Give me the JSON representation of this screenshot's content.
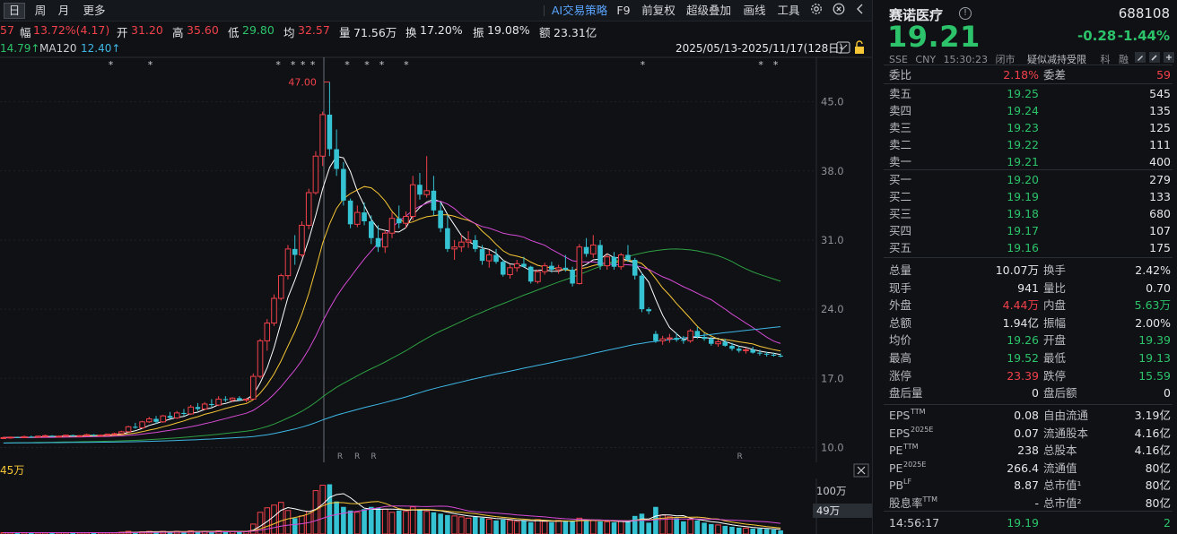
{
  "toolbar": {
    "period_day": "日",
    "period_week": "周",
    "period_month": "月",
    "more": "更多",
    "ai_strategy": "AI交易策略",
    "f9": "F9",
    "adjust": "前复权",
    "overlay": "超级叠加",
    "draw": "画线",
    "tools": "工具"
  },
  "stats": {
    "prev_fragment": "57",
    "amp_label": "幅",
    "amp_value": "13.72%(4.17)",
    "open_label": "开",
    "open_value": "31.20",
    "high_label": "高",
    "high_value": "35.60",
    "low_label": "低",
    "low_value": "29.80",
    "avg_label": "均",
    "avg_value": "32.57",
    "vol_label": "量",
    "vol_value": "71.56万",
    "turn_label": "换",
    "turn_value": "17.20%",
    "swing_label": "振",
    "swing_value": "19.08%",
    "amount_label": "额",
    "amount_value": "23.31亿"
  },
  "ma_row": {
    "ma_prev_value": "14.79↑",
    "ma120_label": "MA120",
    "ma120_value": "12.40↑",
    "date_range": "2025/05/13-2025/11/17(128日)"
  },
  "chart_data": {
    "type": "candlestick",
    "ylim": [
      8.5,
      49.5
    ],
    "y_ticks": [
      "45.0",
      "38.0",
      "31.0",
      "24.0",
      "17.0",
      "10.0"
    ],
    "y_tick_values": [
      45,
      38,
      31,
      24,
      17,
      10
    ],
    "max_label": "47.00",
    "star_label": "*",
    "r_label": "R",
    "candles": [
      [
        11.0,
        11.1,
        10.9,
        11.0
      ],
      [
        11.0,
        11.1,
        10.9,
        11.05
      ],
      [
        11.05,
        11.1,
        10.95,
        11.0
      ],
      [
        11.0,
        11.2,
        10.95,
        11.1
      ],
      [
        11.1,
        11.2,
        11.0,
        11.05
      ],
      [
        11.05,
        11.2,
        11.0,
        11.15
      ],
      [
        11.15,
        11.3,
        11.1,
        11.2
      ],
      [
        11.2,
        11.25,
        11.05,
        11.1
      ],
      [
        11.1,
        11.2,
        11.0,
        11.15
      ],
      [
        11.15,
        11.3,
        11.1,
        11.25
      ],
      [
        11.25,
        11.3,
        11.1,
        11.15
      ],
      [
        11.15,
        11.25,
        11.05,
        11.2
      ],
      [
        11.2,
        11.4,
        11.15,
        11.3
      ],
      [
        11.3,
        11.35,
        11.1,
        11.2
      ],
      [
        11.2,
        11.3,
        11.1,
        11.25
      ],
      [
        11.25,
        11.4,
        11.2,
        11.35
      ],
      [
        11.35,
        11.5,
        11.3,
        11.4
      ],
      [
        11.4,
        11.7,
        11.35,
        11.6
      ],
      [
        11.6,
        12.2,
        11.5,
        12.1
      ],
      [
        12.1,
        12.5,
        11.9,
        12.0
      ],
      [
        12.0,
        12.7,
        11.9,
        12.6
      ],
      [
        12.6,
        13.1,
        12.5,
        12.9
      ],
      [
        12.9,
        13.2,
        12.4,
        12.6
      ],
      [
        12.6,
        13.3,
        12.5,
        13.2
      ],
      [
        13.2,
        13.6,
        12.9,
        13.0
      ],
      [
        13.0,
        13.7,
        12.9,
        13.5
      ],
      [
        13.5,
        13.9,
        13.2,
        13.4
      ],
      [
        13.4,
        14.3,
        13.3,
        14.1
      ],
      [
        14.1,
        14.5,
        13.7,
        13.9
      ],
      [
        13.9,
        14.6,
        13.8,
        14.4
      ],
      [
        14.4,
        14.9,
        14.1,
        14.3
      ],
      [
        14.3,
        15.2,
        14.2,
        14.9
      ],
      [
        14.9,
        15.2,
        14.6,
        14.8
      ],
      [
        14.8,
        15.1,
        14.6,
        15.0
      ],
      [
        15.0,
        15.2,
        14.7,
        14.8
      ],
      [
        14.8,
        15.0,
        14.6,
        14.9
      ],
      [
        14.9,
        17.5,
        14.8,
        17.2
      ],
      [
        17.2,
        21.0,
        17.0,
        20.8
      ],
      [
        20.8,
        23.0,
        19.8,
        22.6
      ],
      [
        22.6,
        25.5,
        22.3,
        25.1
      ],
      [
        25.1,
        27.6,
        24.9,
        27.4
      ],
      [
        27.4,
        30.5,
        27.0,
        30.1
      ],
      [
        30.1,
        31.5,
        28.5,
        29.5
      ],
      [
        29.5,
        32.9,
        29.3,
        32.5
      ],
      [
        32.5,
        36.2,
        32.1,
        35.8
      ],
      [
        35.8,
        40.0,
        35.6,
        39.5
      ],
      [
        39.5,
        44.0,
        38.5,
        43.7
      ],
      [
        43.7,
        47.0,
        39.5,
        40.2
      ],
      [
        40.2,
        42.2,
        37.5,
        38.2
      ],
      [
        38.2,
        38.9,
        34.5,
        35.0
      ],
      [
        35.0,
        35.2,
        32.2,
        32.6
      ],
      [
        32.6,
        34.5,
        32.3,
        33.8
      ],
      [
        33.8,
        34.8,
        32.5,
        32.9
      ],
      [
        32.9,
        33.5,
        30.6,
        31.2
      ],
      [
        31.2,
        32.5,
        29.8,
        30.3
      ],
      [
        30.3,
        32.0,
        29.7,
        31.7
      ],
      [
        31.7,
        33.8,
        31.2,
        33.2
      ],
      [
        33.2,
        34.5,
        32.2,
        32.7
      ],
      [
        32.7,
        33.9,
        32.2,
        33.4
      ],
      [
        33.4,
        37.5,
        33.0,
        36.6
      ],
      [
        36.6,
        37.8,
        35.1,
        35.6
      ],
      [
        35.6,
        39.5,
        35.3,
        36.0
      ],
      [
        36.0,
        37.5,
        33.5,
        34.0
      ],
      [
        34.0,
        34.8,
        31.8,
        32.2
      ],
      [
        32.2,
        33.5,
        29.8,
        30.1
      ],
      [
        30.1,
        31.0,
        29.0,
        30.3
      ],
      [
        30.3,
        31.5,
        29.8,
        30.8
      ],
      [
        30.8,
        31.9,
        30.2,
        31.0
      ],
      [
        31.0,
        31.5,
        29.8,
        30.1
      ],
      [
        30.1,
        30.5,
        28.5,
        28.9
      ],
      [
        28.9,
        30.0,
        28.2,
        29.5
      ],
      [
        29.5,
        30.1,
        28.6,
        28.8
      ],
      [
        28.8,
        29.0,
        27.3,
        27.5
      ],
      [
        27.5,
        28.5,
        27.1,
        28.2
      ],
      [
        28.2,
        29.0,
        27.8,
        28.6
      ],
      [
        28.6,
        29.3,
        28.2,
        28.3
      ],
      [
        28.3,
        28.4,
        26.6,
        26.8
      ],
      [
        26.8,
        28.0,
        26.6,
        27.8
      ],
      [
        27.8,
        28.7,
        27.5,
        28.4
      ],
      [
        28.4,
        28.8,
        27.7,
        28.0
      ],
      [
        28.0,
        28.5,
        27.6,
        28.2
      ],
      [
        28.2,
        29.5,
        27.8,
        28.0
      ],
      [
        28.0,
        28.3,
        26.3,
        26.6
      ],
      [
        26.6,
        30.6,
        26.5,
        30.3
      ],
      [
        30.3,
        31.2,
        29.3,
        29.6
      ],
      [
        29.6,
        31.5,
        29.2,
        30.5
      ],
      [
        30.5,
        31.0,
        28.0,
        28.4
      ],
      [
        28.4,
        29.6,
        28.0,
        29.3
      ],
      [
        29.3,
        29.8,
        28.0,
        28.3
      ],
      [
        28.3,
        29.7,
        28.0,
        29.5
      ],
      [
        29.5,
        30.5,
        28.8,
        29.0
      ],
      [
        29.0,
        29.2,
        27.0,
        27.4
      ],
      [
        27.4,
        27.7,
        23.7,
        24.0
      ],
      [
        24.0,
        24.2,
        23.5,
        23.8
      ],
      [
        21.5,
        21.8,
        20.6,
        20.8
      ],
      [
        20.8,
        21.3,
        20.4,
        21.0
      ],
      [
        21.0,
        21.5,
        20.6,
        21.1
      ],
      [
        21.1,
        21.6,
        20.7,
        20.9
      ],
      [
        20.9,
        21.3,
        20.5,
        20.8
      ],
      [
        20.8,
        22.0,
        20.6,
        21.8
      ],
      [
        21.8,
        22.2,
        21.0,
        21.2
      ],
      [
        21.2,
        21.6,
        20.8,
        21.0
      ],
      [
        21.0,
        21.2,
        20.3,
        20.5
      ],
      [
        20.5,
        20.9,
        20.2,
        20.7
      ],
      [
        20.7,
        21.0,
        20.2,
        20.3
      ],
      [
        20.3,
        20.6,
        19.8,
        20.0
      ],
      [
        20.0,
        20.3,
        19.6,
        19.8
      ],
      [
        19.8,
        20.1,
        19.5,
        19.9
      ],
      [
        19.9,
        20.2,
        19.5,
        19.6
      ],
      [
        19.6,
        19.9,
        19.3,
        19.5
      ],
      [
        19.5,
        19.7,
        19.2,
        19.4
      ],
      [
        19.4,
        19.6,
        19.2,
        19.3
      ],
      [
        19.3,
        19.52,
        19.13,
        19.21
      ]
    ],
    "volumes": [
      3,
      3,
      3,
      3,
      3,
      3,
      3,
      3,
      3,
      3,
      3,
      3,
      3,
      3,
      3,
      3,
      3,
      4,
      6,
      4,
      5,
      6,
      5,
      6,
      4,
      6,
      5,
      7,
      5,
      6,
      6,
      7,
      5,
      6,
      5,
      5,
      22,
      48,
      58,
      64,
      70,
      52,
      35,
      40,
      50,
      96,
      108,
      110,
      72,
      60,
      52,
      48,
      55,
      60,
      58,
      55,
      48,
      52,
      50,
      60,
      55,
      50,
      48,
      45,
      42,
      40,
      38,
      35,
      38,
      36,
      33,
      30,
      32,
      30,
      28,
      30,
      26,
      32,
      28,
      26,
      30,
      28,
      30,
      35,
      32,
      30,
      28,
      27,
      26,
      28,
      28,
      40,
      45,
      25,
      60,
      42,
      38,
      35,
      28,
      32,
      30,
      25,
      22,
      20,
      18,
      16,
      14,
      13,
      12,
      12,
      11,
      10,
      8
    ],
    "ma_colors": [
      "#ffffff",
      "#f7c636",
      "#d64bd6",
      "#2ea043",
      "#3fb7e6"
    ],
    "vol_ticks": [
      "100万",
      "49万"
    ],
    "vol_title_fragment": "45万"
  },
  "panel": {
    "name": "赛诺医疗",
    "code": "688108",
    "price": "19.21",
    "change": "-0.28",
    "change_pct": "-1.44%",
    "exchange": "SSE",
    "currency": "CNY",
    "time": "15:30:23",
    "status": "闭市",
    "tag": "疑似减持受限",
    "tag2": "科",
    "tag3": "融",
    "webi_label": "委比",
    "webi_value": "2.18%",
    "weicha_label": "委差",
    "weicha_value": "59",
    "asks": [
      {
        "label": "卖五",
        "price": "19.25",
        "vol": "545"
      },
      {
        "label": "卖四",
        "price": "19.24",
        "vol": "135"
      },
      {
        "label": "卖三",
        "price": "19.23",
        "vol": "125"
      },
      {
        "label": "卖二",
        "price": "19.22",
        "vol": "111"
      },
      {
        "label": "卖一",
        "price": "19.21",
        "vol": "400"
      }
    ],
    "bids": [
      {
        "label": "买一",
        "price": "19.20",
        "vol": "279"
      },
      {
        "label": "买二",
        "price": "19.19",
        "vol": "133"
      },
      {
        "label": "买三",
        "price": "19.18",
        "vol": "680"
      },
      {
        "label": "买四",
        "price": "19.17",
        "vol": "107"
      },
      {
        "label": "买五",
        "price": "19.16",
        "vol": "175"
      }
    ],
    "stats": [
      {
        "l1": "总量",
        "v1": "10.07万",
        "l2": "换手",
        "v2": "2.42%",
        "c1": "white",
        "c2": "white"
      },
      {
        "l1": "现手",
        "v1": "941",
        "l2": "量比",
        "v2": "0.70",
        "c1": "white",
        "c2": "white"
      },
      {
        "l1": "外盘",
        "v1": "4.44万",
        "l2": "内盘",
        "v2": "5.63万",
        "c1": "red",
        "c2": "green"
      },
      {
        "l1": "总额",
        "v1": "1.94亿",
        "l2": "振幅",
        "v2": "2.00%",
        "c1": "white",
        "c2": "white"
      },
      {
        "l1": "均价",
        "v1": "19.26",
        "l2": "开盘",
        "v2": "19.39",
        "c1": "green",
        "c2": "green"
      },
      {
        "l1": "最高",
        "v1": "19.52",
        "l2": "最低",
        "v2": "19.13",
        "c1": "green",
        "c2": "green"
      },
      {
        "l1": "涨停",
        "v1": "23.39",
        "l2": "跌停",
        "v2": "15.59",
        "c1": "red",
        "c2": "green"
      },
      {
        "l1": "盘后量",
        "v1": "0",
        "l2": "盘后额",
        "v2": "0",
        "c1": "white",
        "c2": "white"
      }
    ],
    "fundamentals": [
      {
        "l1": "EPS",
        "s1": "TTM",
        "v1": "0.08",
        "l2": "自由流通",
        "v2": "3.19亿"
      },
      {
        "l1": "EPS",
        "s1": "2025E",
        "v1": "0.07",
        "l2": "流通股本",
        "v2": "4.16亿"
      },
      {
        "l1": "PE",
        "s1": "TTM",
        "v1": "238",
        "l2": "总股本",
        "v2": "4.16亿"
      },
      {
        "l1": "PE",
        "s1": "2025E",
        "v1": "266.4",
        "l2": "流通值",
        "v2": "80亿"
      },
      {
        "l1": "PB",
        "s1": "LF",
        "v1": "8.87",
        "l2": "总市值¹",
        "v2": "80亿"
      },
      {
        "l1": "股息率",
        "s1": "TTM",
        "v1": "-",
        "l2": "总市值²",
        "v2": "80亿"
      }
    ],
    "tick_time": "14:56:17",
    "tick_price": "19.19",
    "tick_vol": "2"
  }
}
